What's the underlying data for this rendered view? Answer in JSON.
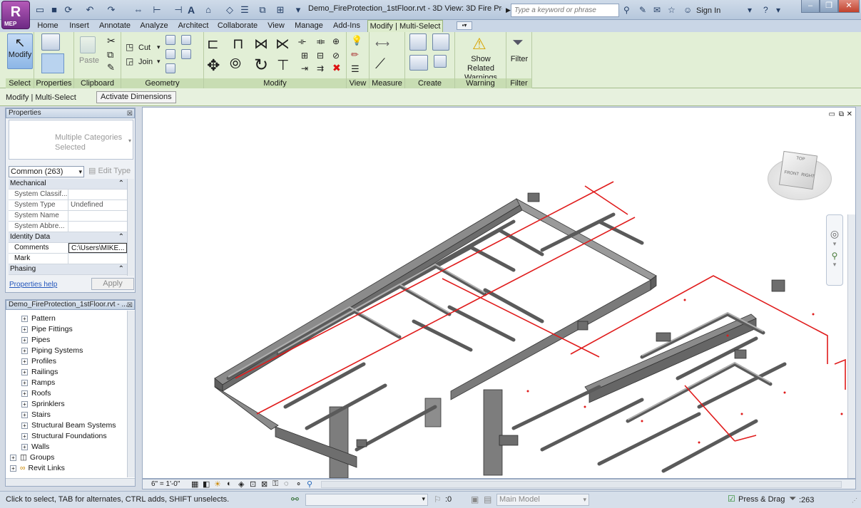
{
  "app": {
    "logo_text": "R",
    "logo_sub": "MEP"
  },
  "title": {
    "document": "Demo_FireProtection_1stFloor.rvt - 3D View: 3D Fire Protect..."
  },
  "search": {
    "placeholder": "Type a keyword or phrase"
  },
  "account": {
    "signin": "Sign In"
  },
  "tabs": [
    {
      "label": "Home"
    },
    {
      "label": "Insert"
    },
    {
      "label": "Annotate"
    },
    {
      "label": "Analyze"
    },
    {
      "label": "Architect"
    },
    {
      "label": "Collaborate"
    },
    {
      "label": "View"
    },
    {
      "label": "Manage"
    },
    {
      "label": "Add-Ins"
    },
    {
      "label": "Modify | Multi-Select"
    }
  ],
  "ribbon": {
    "modify_label": "Modify",
    "properties_label": "Properties",
    "paste_label": "Paste",
    "cut_label": "Cut",
    "join_label": "Join",
    "show_related_warnings": "Show Related Warnings",
    "filter_label": "Filter",
    "panels": {
      "select": "Select",
      "properties": "Properties",
      "clipboard": "Clipboard",
      "geometry": "Geometry",
      "modify": "Modify",
      "view": "View",
      "measure": "Measure",
      "create": "Create",
      "warning": "Warning",
      "filter": "Filter"
    }
  },
  "options_bar": {
    "context": "Modify | Multi-Select",
    "activate_dimensions": "Activate Dimensions"
  },
  "properties": {
    "title": "Properties",
    "type_selector": "Multiple Categories Selected",
    "filter": "Common (263)",
    "edit_type": "Edit Type",
    "rows": [
      {
        "group": "Mechanical"
      },
      {
        "key": "System Classif...",
        "value": ""
      },
      {
        "key": "System Type",
        "value": "Undefined"
      },
      {
        "key": "System Name",
        "value": ""
      },
      {
        "key": "System Abbre...",
        "value": ""
      },
      {
        "group": "Identity Data"
      },
      {
        "key": "Comments",
        "value": "C:\\Users\\MIKE..."
      },
      {
        "key": "Mark",
        "value": ""
      },
      {
        "group": "Phasing"
      }
    ],
    "help": "Properties help",
    "apply": "Apply"
  },
  "browser": {
    "title": "Demo_FireProtection_1stFloor.rvt - ...",
    "items": [
      {
        "label": "Pattern"
      },
      {
        "label": "Pipe Fittings"
      },
      {
        "label": "Pipes"
      },
      {
        "label": "Piping Systems"
      },
      {
        "label": "Profiles"
      },
      {
        "label": "Railings"
      },
      {
        "label": "Ramps"
      },
      {
        "label": "Roofs"
      },
      {
        "label": "Sprinklers"
      },
      {
        "label": "Stairs"
      },
      {
        "label": "Structural Beam Systems"
      },
      {
        "label": "Structural Foundations"
      },
      {
        "label": "Walls"
      },
      {
        "label": "Groups"
      },
      {
        "label": "Revit Links"
      }
    ]
  },
  "viewcube": {
    "top": "TOP",
    "front": "FRONT",
    "right": "RIGHT"
  },
  "view_control": {
    "scale": "6\" = 1'-0\""
  },
  "status": {
    "hint": "Click to select, TAB for alternates, CTRL adds, SHIFT unselects.",
    "worksets": ":0",
    "model": "Main Model",
    "press_drag": "Press & Drag",
    "selected_count": ":263"
  },
  "colors": {
    "ribbon_bg": "#e2efd6",
    "pipe_gray": "#8b8b8b",
    "fire_red": "#e01b1b"
  }
}
